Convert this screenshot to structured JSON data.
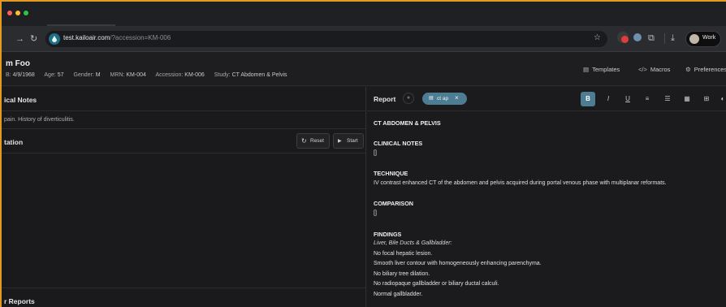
{
  "browser": {
    "url_host": "test.kailoair.com",
    "url_path": "/?accession=KM-006",
    "profile_label": "Work",
    "traffic_colors": [
      "#ff5f57",
      "#febc2e",
      "#28c840"
    ]
  },
  "patient": {
    "name": "m Foo",
    "meta": [
      {
        "label": "B:",
        "value": "4/9/1968"
      },
      {
        "label": "Age:",
        "value": "57"
      },
      {
        "label": "Gender:",
        "value": "M"
      },
      {
        "label": "MRN:",
        "value": "KM-004"
      },
      {
        "label": "Accession:",
        "value": "KM-006"
      },
      {
        "label": "Study:",
        "value": "CT Abdomen & Pelvis"
      }
    ]
  },
  "header_links": {
    "templates": "Templates",
    "macros": "Macros",
    "preferences": "Preferences"
  },
  "left": {
    "clinical_notes_title": "ical Notes",
    "clinical_notes_text": "pain. History of diverticulitis.",
    "dictation_title": "tation",
    "reset_label": "Reset",
    "start_label": "Start",
    "prior_reports_title": "r Reports"
  },
  "report": {
    "title": "Report",
    "chip_label": "ct ap",
    "lines": [
      {
        "text": "CT ABDOMEN & PELVIS",
        "style": "h"
      },
      {
        "text": "CLINICAL NOTES",
        "style": "h"
      },
      {
        "text": "[]",
        "style": "n"
      },
      {
        "text": "TECHNIQUE",
        "style": "h"
      },
      {
        "text": "IV contrast enhanced CT of the abdomen and pelvis acquired during portal venous phase with multiplanar reformats.",
        "style": "n"
      },
      {
        "text": "COMPARISON",
        "style": "h"
      },
      {
        "text": "[]",
        "style": "n"
      },
      {
        "text": "FINDINGS",
        "style": "h"
      },
      {
        "text": "Liver, Bile Ducts & Gallbladder:",
        "style": "it"
      },
      {
        "text": "No focal hepatic lesion.",
        "style": "n"
      },
      {
        "text": "Smooth liver contour with homogeneously enhancing parenchyma.",
        "style": "n"
      },
      {
        "text": "No biliary tree dilation.",
        "style": "n"
      },
      {
        "text": "No radiopaque gallbladder or biliary ductal calculi.",
        "style": "n"
      },
      {
        "text": "Normal gallbladder.",
        "style": "n"
      }
    ]
  },
  "colors": {
    "accent": "#4d7d92",
    "window_border": "#e39a1f"
  }
}
